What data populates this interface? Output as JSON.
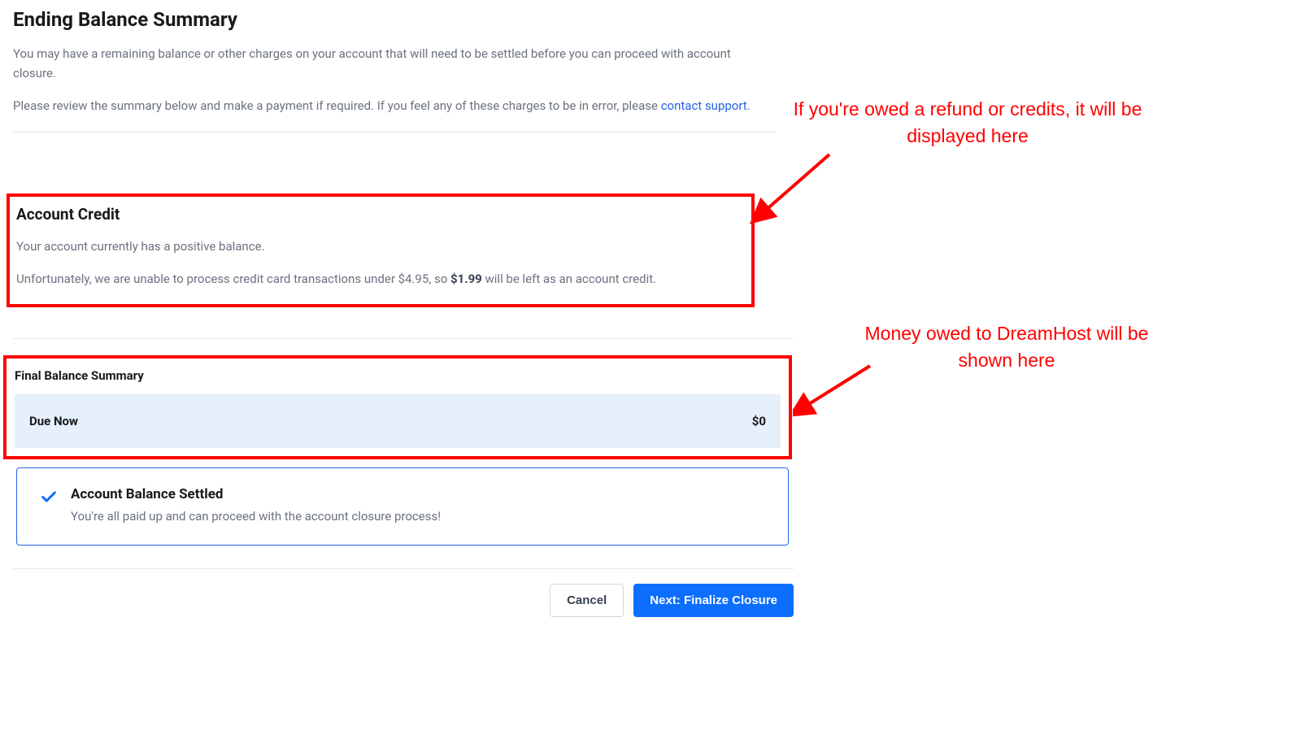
{
  "header": {
    "title": "Ending Balance Summary",
    "intro1": "You may have a remaining balance or other charges on your account that will need to be settled before you can proceed with account closure.",
    "intro2_pre": "Please review the summary below and make a payment if required. If you feel any of these charges to be in error, please ",
    "intro2_link": "contact support",
    "intro2_post": "."
  },
  "account_credit": {
    "heading": "Account Credit",
    "line1": "Your account currently has a positive balance.",
    "line2_pre": "Unfortunately, we are unable to process credit card transactions under $4.95, so ",
    "line2_bold": "$1.99",
    "line2_post": " will be left as an account credit."
  },
  "final_balance": {
    "heading": "Final Balance Summary",
    "due_label": "Due Now",
    "due_amount": "$0"
  },
  "settled": {
    "title": "Account Balance Settled",
    "text": "You're all paid up and can proceed with the account closure process!"
  },
  "buttons": {
    "cancel": "Cancel",
    "next": "Next: Finalize Closure"
  },
  "annotations": {
    "a1": "If you're owed a refund or credits, it will be displayed here",
    "a2": "Money owed to DreamHost will be shown here"
  }
}
